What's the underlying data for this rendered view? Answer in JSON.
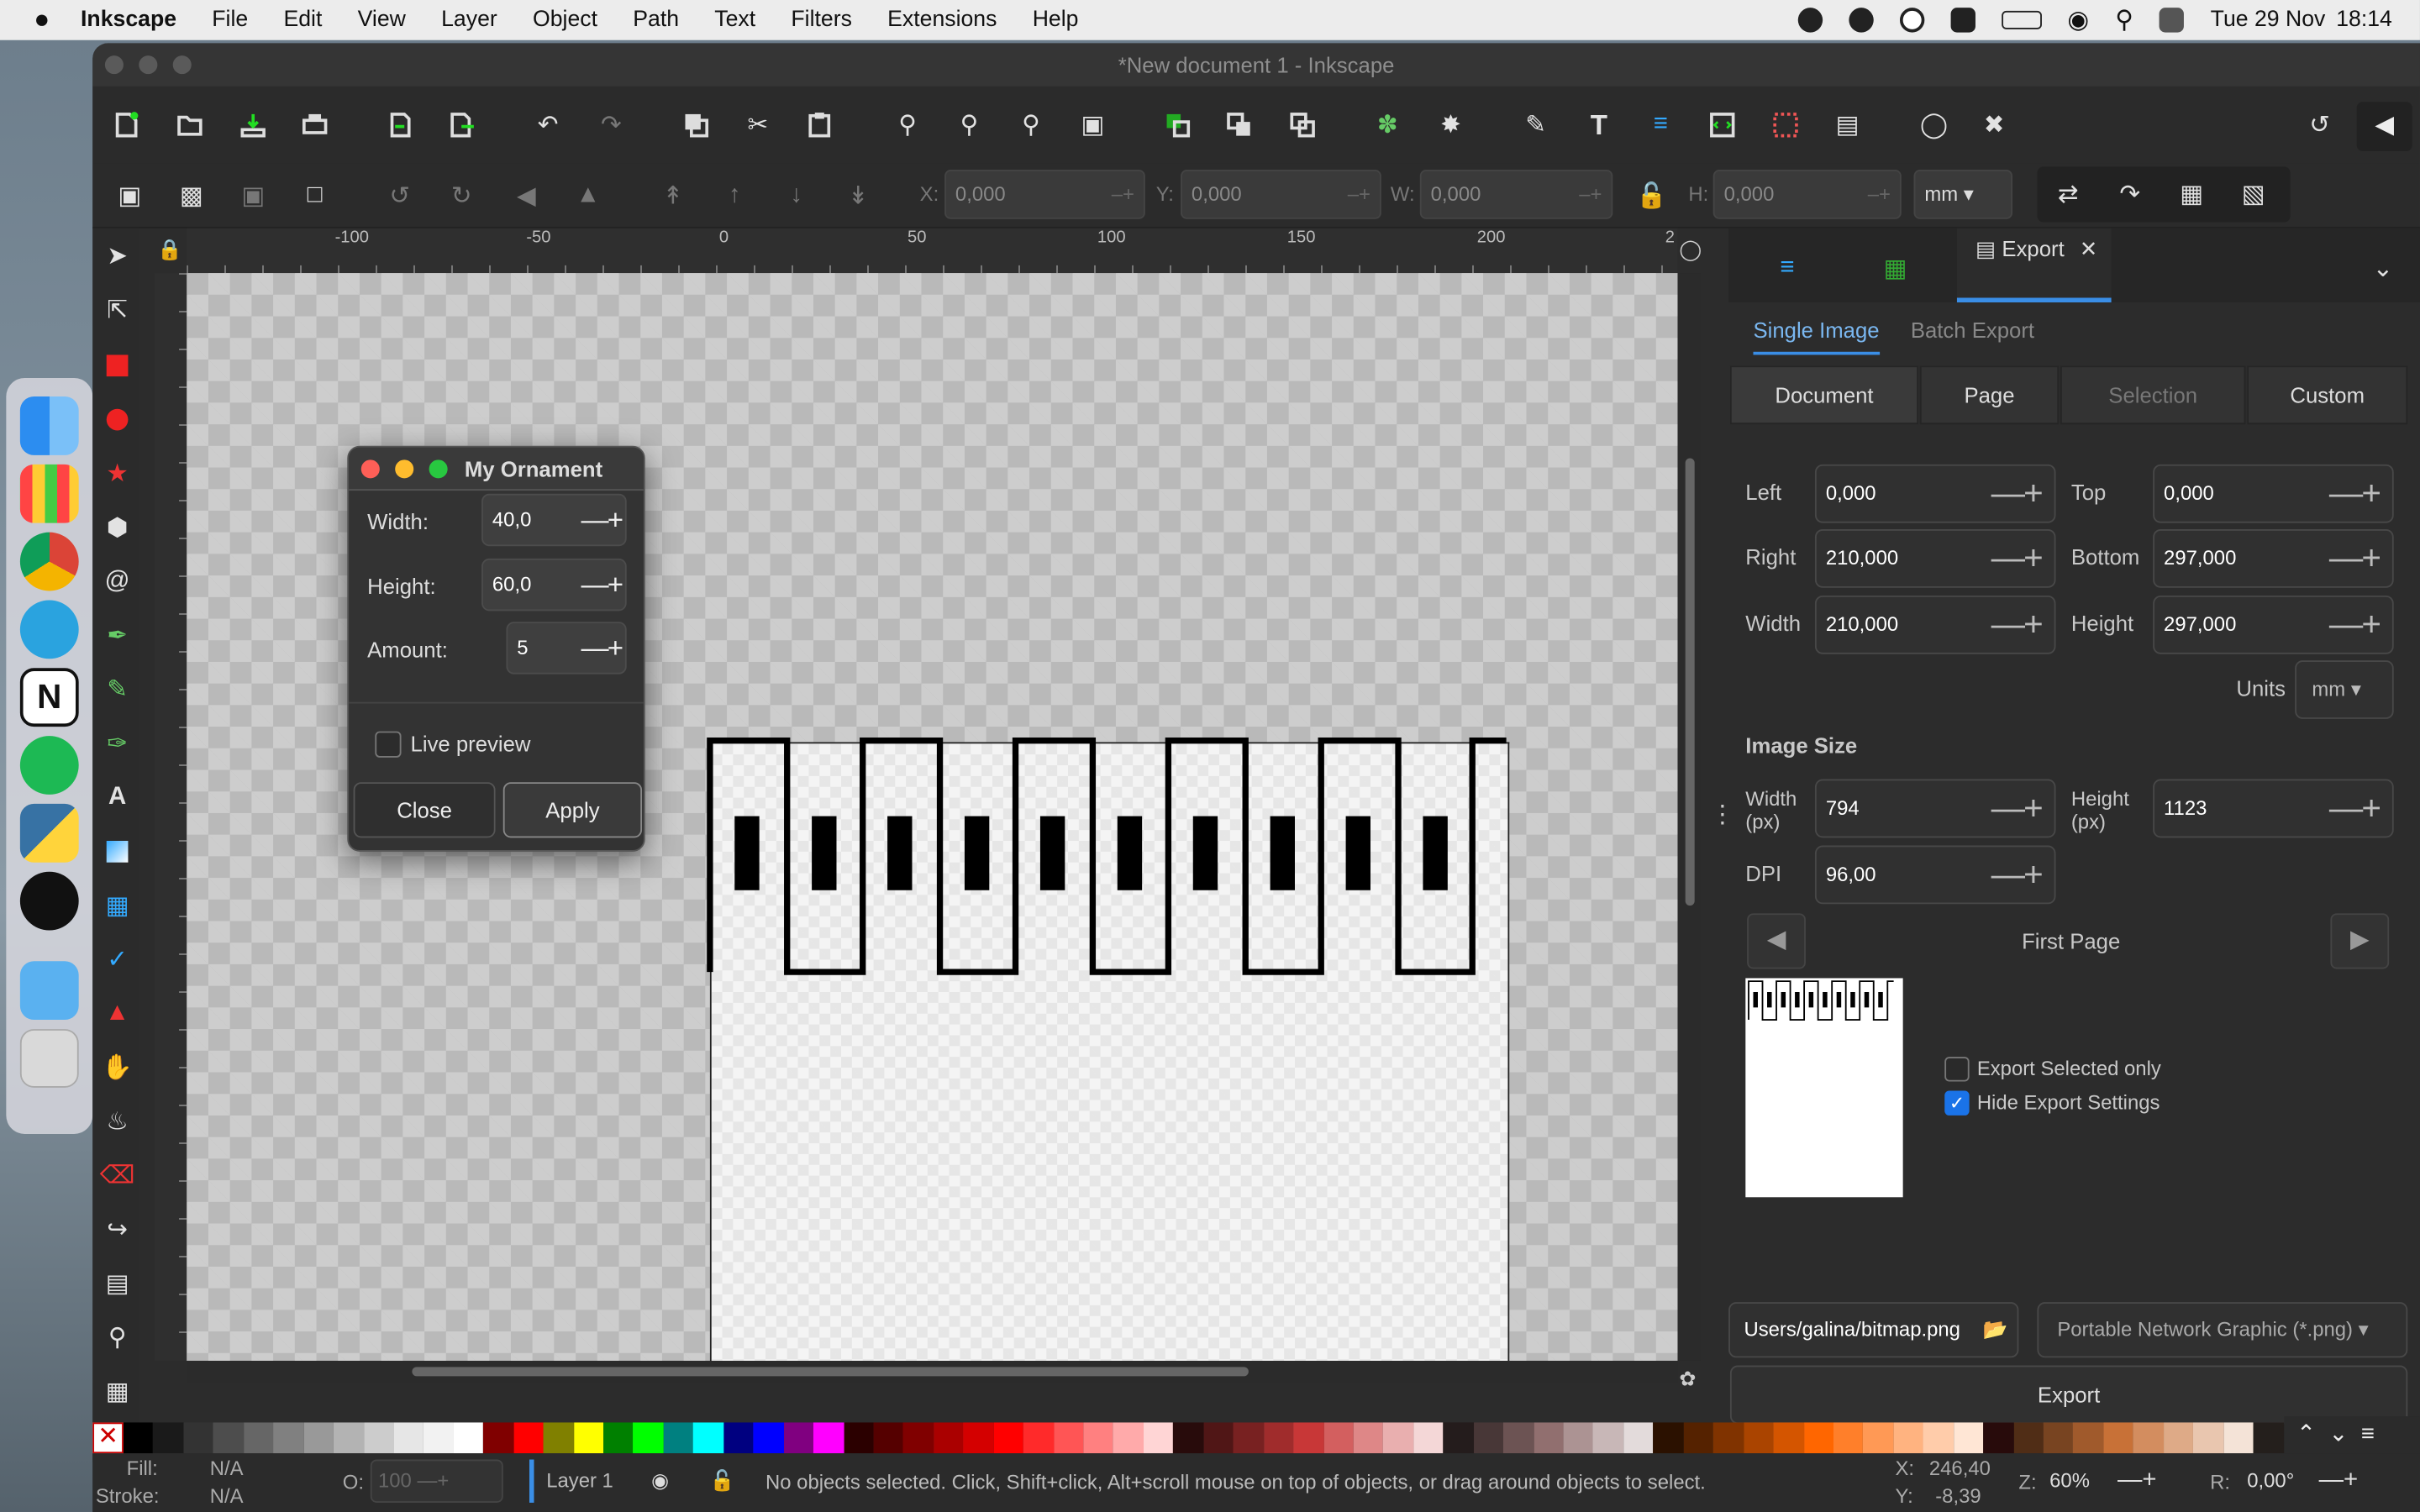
{
  "menubar": {
    "app": "Inkscape",
    "items": [
      "File",
      "Edit",
      "View",
      "Layer",
      "Object",
      "Path",
      "Text",
      "Filters",
      "Extensions",
      "Help"
    ],
    "date": "Tue 29 Nov",
    "time": "18:14"
  },
  "window": {
    "title": "*New document 1 - Inkscape"
  },
  "toolbar2": {
    "x_label": "X:",
    "x": "0,000",
    "y_label": "Y:",
    "y": "0,000",
    "w_label": "W:",
    "w": "0,000",
    "h_label": "H:",
    "h": "0,000",
    "unit": "mm"
  },
  "ruler": {
    "ticks": [
      "-100",
      "-50",
      "0",
      "50",
      "100",
      "150",
      "200",
      "2"
    ]
  },
  "dialog": {
    "title": "My Ornament",
    "width_label": "Width:",
    "width": "40,0",
    "height_label": "Height:",
    "height": "60,0",
    "amount_label": "Amount:",
    "amount": "5",
    "live_preview": "Live preview",
    "close": "Close",
    "apply": "Apply"
  },
  "export": {
    "tab_label": "Export",
    "subtabs": [
      "Single Image",
      "Batch Export"
    ],
    "areas": [
      "Document",
      "Page",
      "Selection",
      "Custom"
    ],
    "left_label": "Left",
    "left": "0,000",
    "top_label": "Top",
    "top": "0,000",
    "right_label": "Right",
    "right": "210,000",
    "bottom_label": "Bottom",
    "bottom": "297,000",
    "width_label": "Width",
    "width": "210,000",
    "height_label": "Height",
    "height": "297,000",
    "units_label": "Units",
    "units": "mm",
    "image_size": "Image Size",
    "wpx_label": "Width (px)",
    "wpx": "794",
    "hpx_label": "Height (px)",
    "hpx": "1123",
    "dpi_label": "DPI",
    "dpi": "96,00",
    "page_nav": "First Page",
    "export_selected": "Export Selected only",
    "hide_settings": "Hide Export Settings",
    "hide_checked": true,
    "filename": "Users/galina/bitmap.png",
    "format": "Portable Network Graphic (*.png)",
    "export_button": "Export"
  },
  "status": {
    "fill_label": "Fill:",
    "fill": "N/A",
    "stroke_label": "Stroke:",
    "stroke": "N/A",
    "opacity_label": "O:",
    "opacity": "100",
    "layer": "Layer 1",
    "message": "No objects selected. Click, Shift+click, Alt+scroll mouse on top of objects, or drag around objects to select.",
    "x_label": "X:",
    "x": "246,40",
    "y_label": "Y:",
    "y": "-8,39",
    "zoom_label": "Z:",
    "zoom": "60%",
    "rot_label": "R:",
    "rotation": "0,00°"
  },
  "palette": [
    "#000000",
    "#1a1a1a",
    "#333333",
    "#4d4d4d",
    "#666666",
    "#808080",
    "#999999",
    "#b3b3b3",
    "#cccccc",
    "#e6e6e6",
    "#f2f2f2",
    "#ffffff",
    "#800000",
    "#ff0000",
    "#808000",
    "#ffff00",
    "#008000",
    "#00ff00",
    "#008080",
    "#00ffff",
    "#000080",
    "#0000ff",
    "#800080",
    "#ff00ff",
    "#2b0000",
    "#550000",
    "#800000",
    "#aa0000",
    "#d40000",
    "#ff0000",
    "#ff2a2a",
    "#ff5555",
    "#ff8080",
    "#ffaaaa",
    "#ffd5d5",
    "#280b0b",
    "#501616",
    "#782121",
    "#a02c2c",
    "#c83737",
    "#d35f5f",
    "#de8787",
    "#e9afaf",
    "#f4d7d7",
    "#241c1c",
    "#483737",
    "#6c5353",
    "#916f6f",
    "#ac9393",
    "#c8b7b7",
    "#e3dbdb",
    "#2b1100",
    "#552200",
    "#803300",
    "#aa4400",
    "#d45500",
    "#ff6600",
    "#ff7f2a",
    "#ff9955",
    "#ffb380",
    "#ffccaa",
    "#ffe6d5",
    "#280b0b",
    "#502d16",
    "#784421",
    "#a05a2c",
    "#c87137",
    "#d38d5f",
    "#deaa87",
    "#e9c6af",
    "#f4e3d7",
    "#241f1c"
  ]
}
